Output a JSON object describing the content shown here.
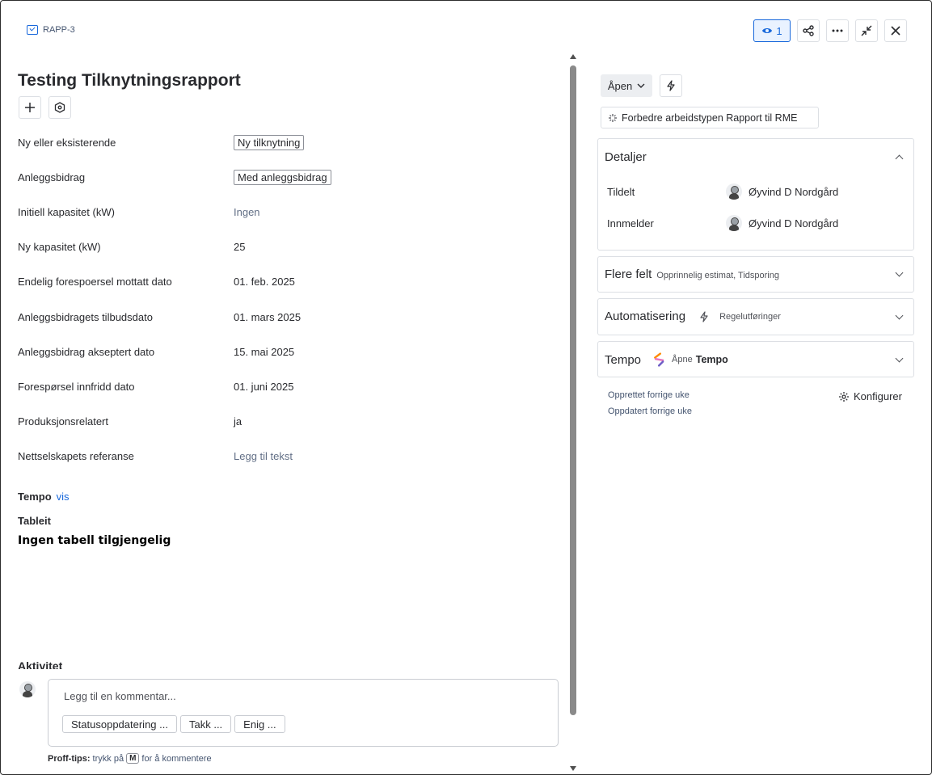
{
  "header": {
    "issue_key": "RAPP-3",
    "watch_count": "1"
  },
  "issue": {
    "title": "Testing Tilknytningsrapport",
    "fields": [
      {
        "label": "Ny eller eksisterende",
        "value": "Ny tilknytning"
      },
      {
        "label": "Anleggsbidrag",
        "value": "Med anleggsbidrag"
      },
      {
        "label": "Initiell kapasitet (kW)",
        "value": "Ingen"
      },
      {
        "label": "Ny kapasitet (kW)",
        "value": "25"
      },
      {
        "label": "Endelig forespoersel mottatt dato",
        "value": "01. feb. 2025"
      },
      {
        "label": "Anleggsbidragets tilbudsdato",
        "value": "01. mars 2025"
      },
      {
        "label": "Anleggsbidrag akseptert dato",
        "value": "15. mai 2025"
      },
      {
        "label": "Forespørsel innfridd dato",
        "value": "01. juni 2025"
      },
      {
        "label": "Produksjonsrelatert",
        "value": "ja"
      },
      {
        "label": "Nettselskapets referanse",
        "value": "Legg til tekst"
      }
    ],
    "tempo_label": "Tempo",
    "tempo_link": "vis",
    "tableit_label": "Tableit",
    "no_table_text": "Ingen tabell tilgjengelig",
    "activity_label": "Aktivitet"
  },
  "comment": {
    "placeholder": "Legg til en kommentar...",
    "chips": [
      "Statusoppdatering ...",
      "Takk ...",
      "Enig ..."
    ],
    "protip_bold": "Proff-tips:",
    "protip_pre": "trykk på",
    "protip_key": "M",
    "protip_post": "for å kommentere"
  },
  "sidebar": {
    "status": "Åpen",
    "improve_label": "Forbedre arbeidstypen Rapport til RME",
    "details": {
      "title": "Detaljer",
      "assignee_label": "Tildelt",
      "assignee_name": "Øyvind D Nordgård",
      "reporter_label": "Innmelder",
      "reporter_name": "Øyvind D Nordgård"
    },
    "more_fields": {
      "title": "Flere felt",
      "subtitle": "Opprinnelig estimat, Tidsporing"
    },
    "automation": {
      "title": "Automatisering",
      "subtitle": "Regelutføringer"
    },
    "tempo": {
      "title": "Tempo",
      "open_label": "Åpne",
      "open_app": "Tempo"
    },
    "created": "Opprettet forrige uke",
    "updated": "Oppdatert forrige uke",
    "configure": "Konfigurer"
  },
  "colors": {
    "accent": "#1868db",
    "watch_bg": "#e9f2ff",
    "border": "#dcdfe4"
  }
}
